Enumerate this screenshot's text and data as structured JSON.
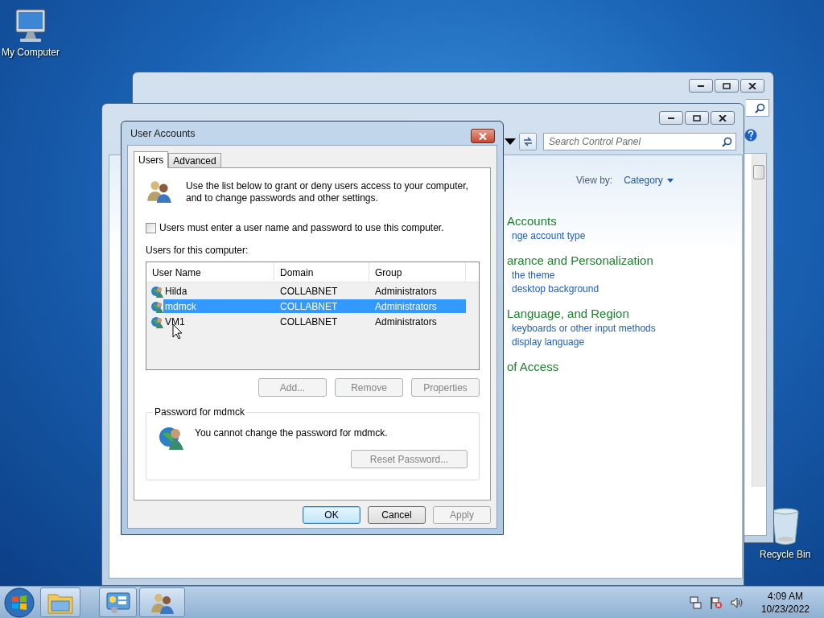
{
  "desktop_icons": [
    {
      "kind": "computer",
      "label": "My Computer"
    },
    {
      "kind": "recycle",
      "label": "Recycle Bin"
    }
  ],
  "control_panel": {
    "search": {
      "placeholder": "Search Control Panel"
    },
    "view_by": {
      "label": "View by:",
      "value": "Category"
    },
    "categories": [
      {
        "title": "Accounts",
        "links": [
          "nge account type"
        ]
      },
      {
        "title": "arance and Personalization",
        "links": [
          "the theme",
          "desktop background"
        ]
      },
      {
        "title": "Language, and Region",
        "links": [
          "keyboards or other input methods",
          "display language"
        ]
      },
      {
        "title": "of Access"
      }
    ]
  },
  "dialog": {
    "title": "User Accounts",
    "tabs": [
      {
        "label": "Users",
        "selected": true
      },
      {
        "label": "Advanced",
        "selected": false
      }
    ],
    "intro": "Use the list below to grant or deny users access to your computer, and to change passwords and other settings.",
    "require_login": {
      "label": "Users must enter a user name and password to use this computer.",
      "checked": false
    },
    "list_label": "Users for this computer:",
    "columns": [
      "User Name",
      "Domain",
      "Group"
    ],
    "rows": [
      {
        "user": "Hilda",
        "domain": "COLLABNET",
        "group": "Administrators",
        "selected": false
      },
      {
        "user": "mdmck",
        "domain": "COLLABNET",
        "group": "Administrators",
        "selected": true
      },
      {
        "user": "VM1",
        "domain": "COLLABNET",
        "group": "Administrators",
        "selected": false
      }
    ],
    "list_buttons": [
      {
        "label": "Add...",
        "disabled": true
      },
      {
        "label": "Remove",
        "disabled": true
      },
      {
        "label": "Properties",
        "disabled": true
      }
    ],
    "password_group": {
      "title": "Password for mdmck",
      "message": "You cannot change the password for mdmck.",
      "button": {
        "label": "Reset Password...",
        "disabled": true
      }
    },
    "buttons": [
      {
        "label": "OK",
        "disabled": false,
        "default": true
      },
      {
        "label": "Cancel",
        "disabled": false,
        "default": false
      },
      {
        "label": "Apply",
        "disabled": true,
        "default": false
      }
    ]
  },
  "taskbar": {
    "buttons": [
      {
        "kind": "explorer"
      },
      {
        "kind": "control_panel"
      },
      {
        "kind": "user_accounts"
      }
    ],
    "clock": {
      "time": "4:09 AM",
      "date": "10/23/2022"
    }
  }
}
